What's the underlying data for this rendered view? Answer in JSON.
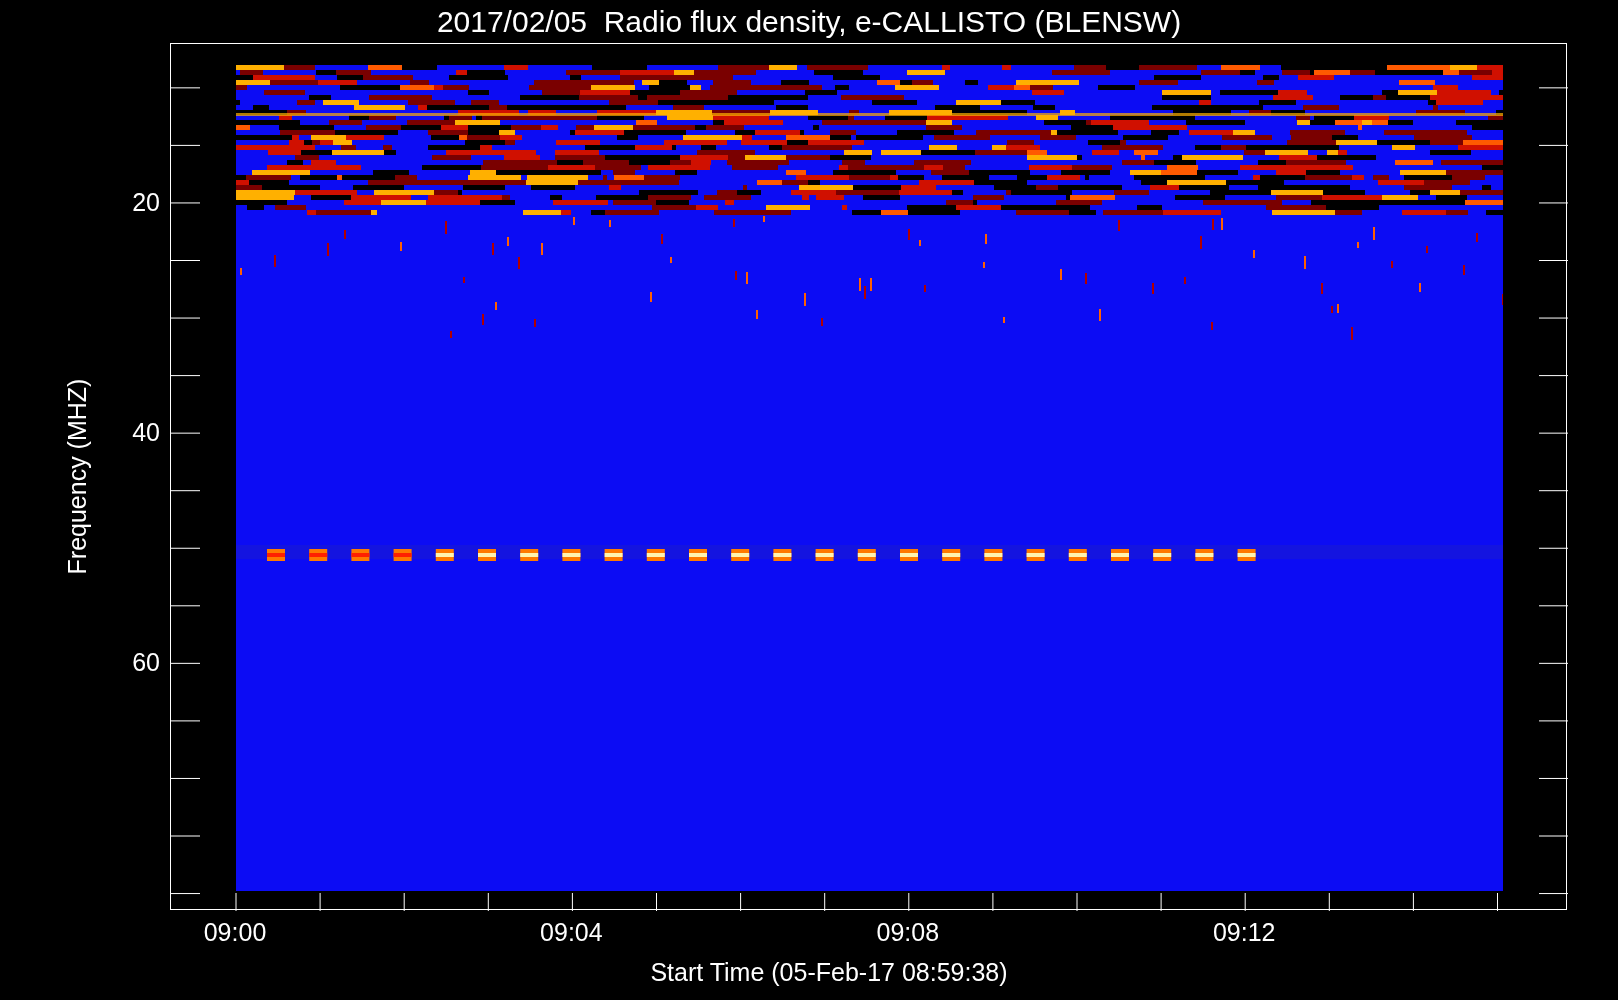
{
  "title": "2017/02/05  Radio flux density, e-CALLISTO (BLENSW)",
  "y_axis": {
    "label": "Frequency (MHZ)",
    "ticks": [
      "20",
      "40",
      "60"
    ]
  },
  "x_axis": {
    "label": "Start Time (05-Feb-17 08:59:38)",
    "ticks": [
      "09:00",
      "09:04",
      "09:08",
      "09:12"
    ]
  }
}
